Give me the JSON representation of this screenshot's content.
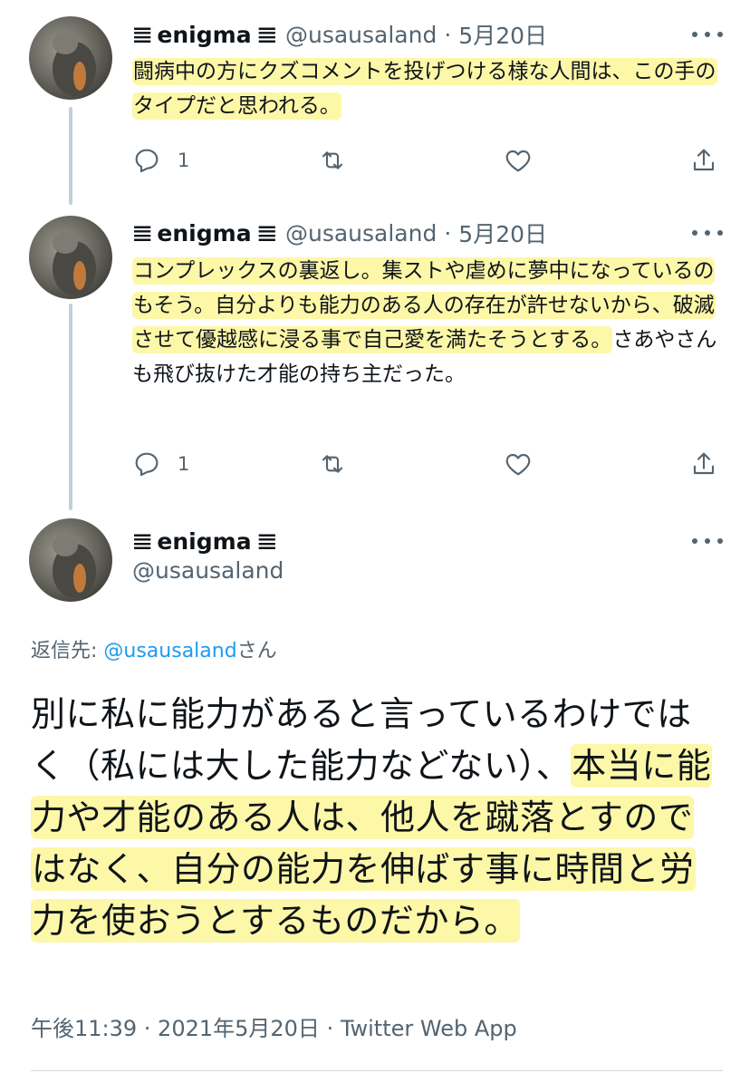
{
  "tweets": [
    {
      "display_name": "enigma",
      "name_bars": "𝌆",
      "handle": "@usausaland",
      "separator": "·",
      "date": "5月20日",
      "text_highlighted": "闘病中の方にクズコメントを投げつける様な人間は、この手のタイプだと思われる。",
      "reply_count": "1"
    },
    {
      "display_name": "enigma",
      "name_bars": "𝌆",
      "handle": "@usausaland",
      "separator": "·",
      "date": "5月20日",
      "text_highlighted": "コンプレックスの裏返し。集ストや虐めに夢中になっているのもそう。自分よりも能力のある人の存在が許せないから、破滅させて優越感に浸る事で自己愛を満たそうとする。",
      "text_plain": "さあやさんも飛び抜けた才能の持ち主だった。",
      "reply_count": "1"
    }
  ],
  "main_tweet": {
    "display_name": "enigma",
    "name_bars": "𝌆",
    "handle": "@usausaland",
    "reply_label": "返信先: ",
    "reply_mention": "@usausaland",
    "reply_suffix": "さん",
    "text_plain": "別に私に能力があると言っているわけではく（私には大した能力などない）、",
    "text_highlighted": "本当に能力や才能のある人は、他人を蹴落とすのではなく、自分の能力を伸ばす事に時間と労力を使おうとするものだから。",
    "meta": "午後11:39 · 2021年5月20日 · Twitter Web App"
  },
  "icons": {
    "more": "more-horizontal-icon",
    "reply": "reply-icon",
    "retweet": "retweet-icon",
    "like": "heart-icon",
    "share": "share-icon"
  },
  "colors": {
    "highlight": "#fdf7a8",
    "secondary_text": "#536471",
    "link": "#1d9bf0",
    "thread_line": "#c4cfd6"
  }
}
